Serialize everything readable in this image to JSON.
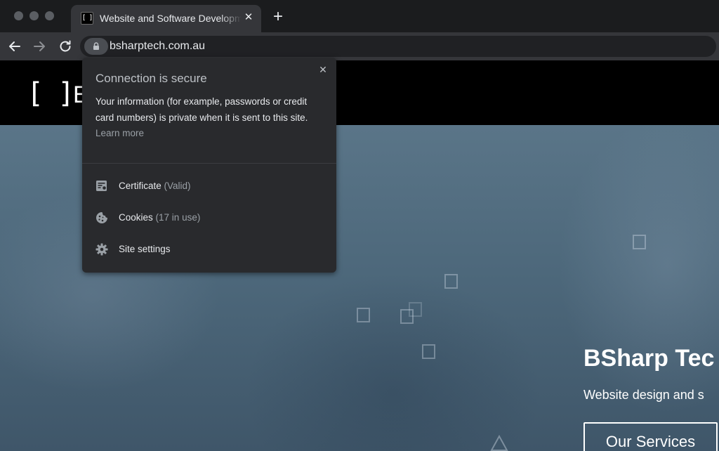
{
  "browser": {
    "tab": {
      "favicon_text": "[ ]",
      "title": "Website and Software Development",
      "close_symbol": "✕"
    },
    "new_tab_symbol": "+",
    "url": "bsharptech.com.au"
  },
  "popup": {
    "title": "Connection is secure",
    "close_symbol": "✕",
    "description": "Your information (for example, passwords or credit card numbers) is private when it is sent to this site.",
    "learn_more": "Learn more",
    "items": [
      {
        "label": "Certificate",
        "detail": "(Valid)",
        "icon": "certificate-icon"
      },
      {
        "label": "Cookies",
        "detail": "(17 in use)",
        "icon": "cookie-icon"
      },
      {
        "label": "Site settings",
        "detail": "",
        "icon": "gear-icon"
      }
    ]
  },
  "site": {
    "logo_brackets": "[ ]",
    "logo_partial_text": "E",
    "hero_title": "BSharp Tec",
    "hero_subtitle": "Website design and s",
    "cta": "Our Services"
  },
  "colors": {
    "tab_bar": "#1b1c1e",
    "toolbar": "#35363a",
    "popup_bg": "#292a2d",
    "hero_blue": "#4d687b",
    "text_primary": "#e8eaed",
    "text_secondary": "#9aa0a6"
  }
}
